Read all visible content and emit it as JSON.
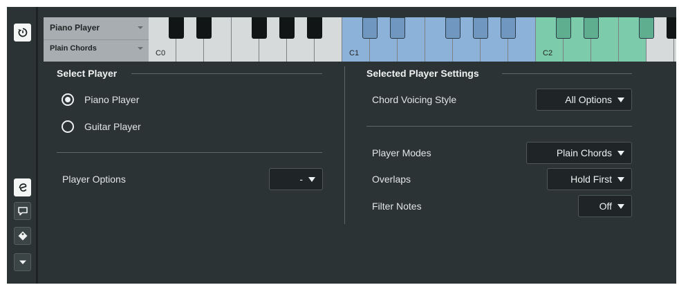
{
  "keyboard": {
    "player_name": "Piano Player",
    "player_mode": "Plain Chords",
    "octave_labels": [
      "C0",
      "C1",
      "C2"
    ],
    "colors": {
      "white_plain": "#d6dadb",
      "white_blue": "#8cb2d9",
      "white_green": "#7ccbaa",
      "black_plain": "#121516",
      "black_blue": "#6f97bf",
      "black_green": "#5fae8f"
    }
  },
  "icons": {
    "rail_top": "reset-icon",
    "rail_1": "edit-e-icon",
    "rail_2": "comment-icon",
    "rail_3": "tag-icon",
    "rail_4": "collapse-arrow-icon"
  },
  "select_player": {
    "title": "Select Player",
    "options": [
      {
        "label": "Piano Player",
        "selected": true
      },
      {
        "label": "Guitar Player",
        "selected": false
      }
    ],
    "player_options_label": "Player Options",
    "player_options_value": "-"
  },
  "settings": {
    "title": "Selected Player Settings",
    "chord_voicing_label": "Chord Voicing Style",
    "chord_voicing_value": "All Options",
    "player_modes_label": "Player Modes",
    "player_modes_value": "Plain Chords",
    "overlaps_label": "Overlaps",
    "overlaps_value": "Hold First",
    "filter_notes_label": "Filter Notes",
    "filter_notes_value": "Off"
  }
}
